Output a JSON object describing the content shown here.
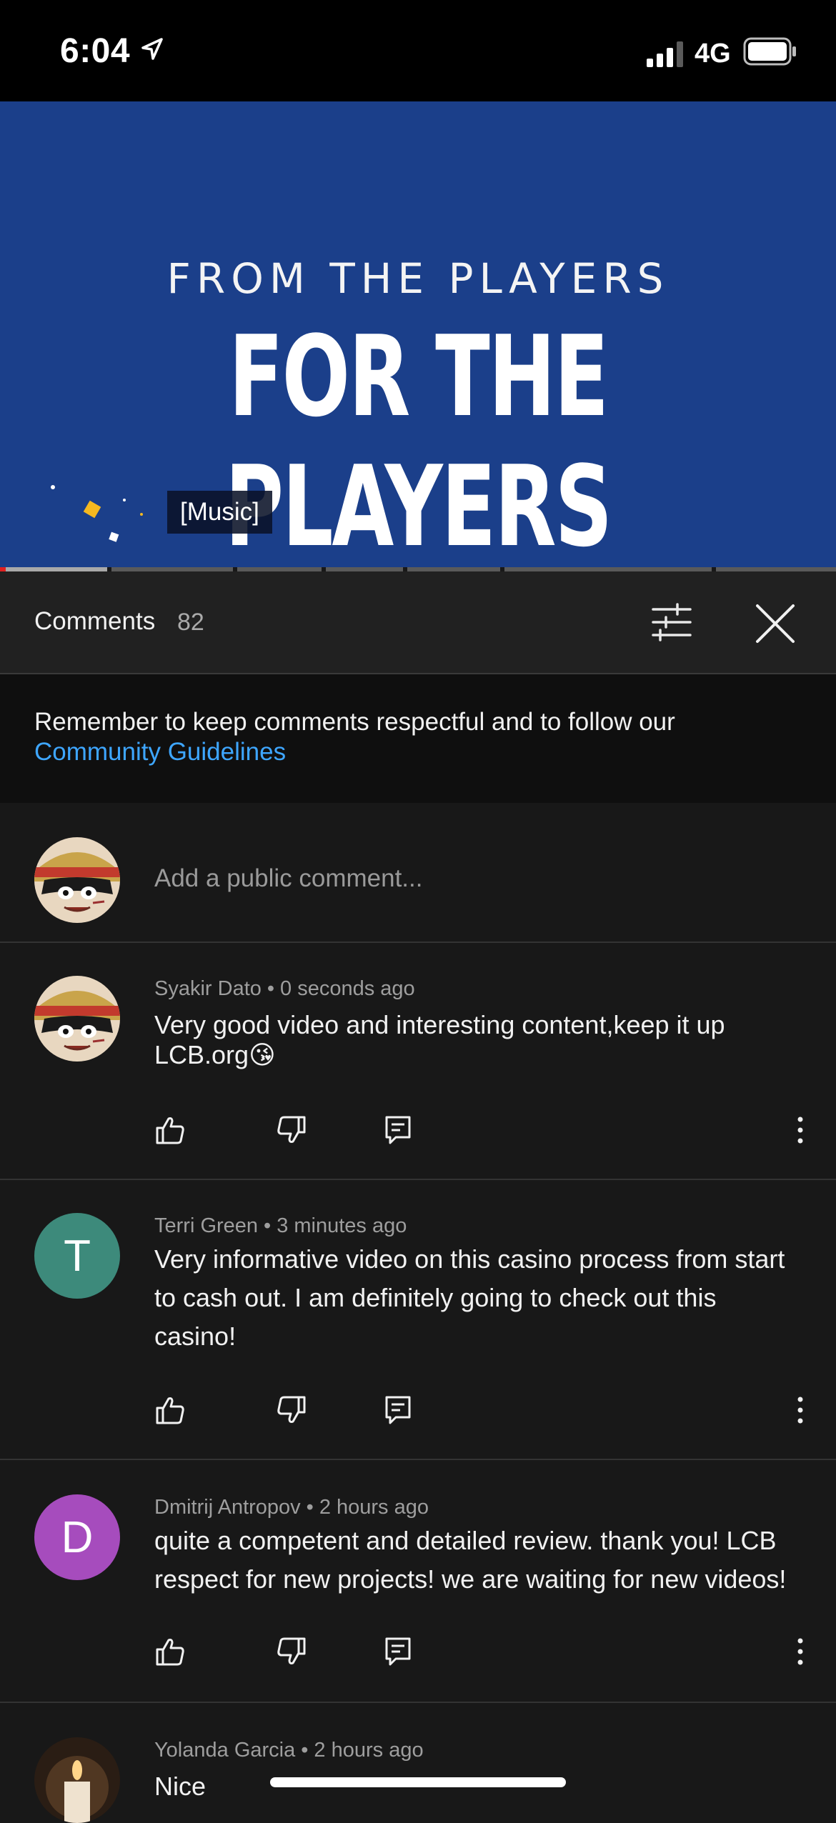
{
  "status_bar": {
    "time": "6:04",
    "network": "4G"
  },
  "video": {
    "line1": "FROM THE PLAYERS",
    "line2": "FOR THE PLAYERS",
    "caption": "[Music]",
    "progress_fraction": 0.007,
    "buffer_fraction": 0.128
  },
  "comments_panel": {
    "title": "Comments",
    "count": "82",
    "notice_text": "Remember to keep comments respectful and to follow our ",
    "notice_link": "Community Guidelines",
    "add_placeholder": "Add a public comment..."
  },
  "comments": [
    {
      "author": "Syakir Dato",
      "time": "0 seconds ago",
      "text": "Very good video and interesting content,keep it up LCB.org😘",
      "avatar": "anime-avatar"
    },
    {
      "author": "Terri Green",
      "time": "3 minutes ago",
      "text": "Very informative video on this casino process from start to cash out. I am definitely going to check out this casino!",
      "avatar_letter": "T",
      "avatar_color": "#3d8a7b"
    },
    {
      "author": "Dmitrij Antropov",
      "time": "2 hours ago",
      "text": "quite a competent and detailed review. thank you! LCB respect for new projects! we are waiting for new videos!",
      "avatar_letter": "D",
      "avatar_color": "#a64cbd"
    },
    {
      "author": "Yolanda Garcia",
      "time": "2 hours ago",
      "text": "Nice",
      "avatar": "candle-avatar"
    }
  ],
  "colors": {
    "video_bg": "#1b3f8a",
    "progress": "#e02020",
    "link": "#3ea6ff",
    "panel_bg": "#181818"
  },
  "icons": [
    "location-arrow-icon",
    "signal-icon",
    "battery-icon",
    "sort-icon",
    "close-icon",
    "like-icon",
    "dislike-icon",
    "reply-icon",
    "more-icon"
  ]
}
